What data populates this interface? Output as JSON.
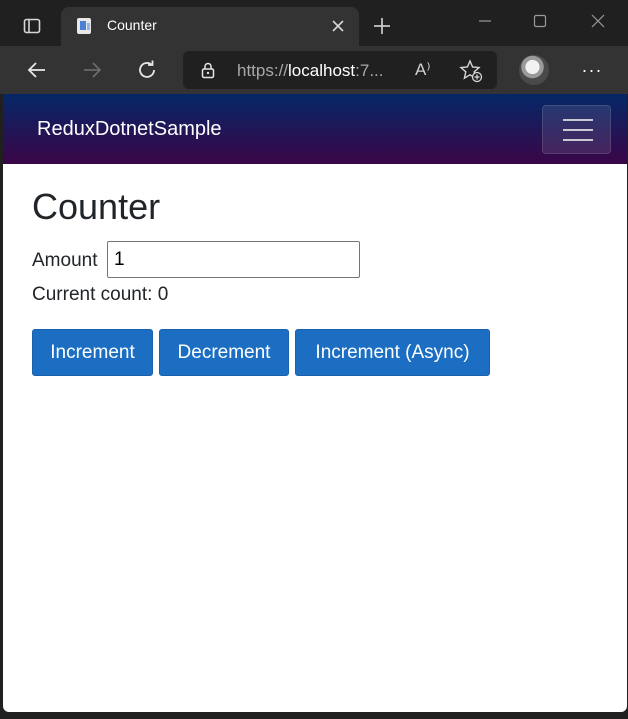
{
  "browser": {
    "tab": {
      "title": "Counter"
    },
    "address": {
      "url_prefix": "https://",
      "url_host": "localhost",
      "url_suffix": ":7..."
    },
    "readaloud_label": "A⁾",
    "menu_label": "···"
  },
  "app": {
    "brand": "ReduxDotnetSample"
  },
  "page": {
    "title": "Counter",
    "amount_label": "Amount",
    "amount_value": "1",
    "current_count_label": "Current count:",
    "current_count_value": "0",
    "buttons": {
      "increment": "Increment",
      "decrement": "Decrement",
      "increment_async": "Increment (Async)"
    }
  },
  "colors": {
    "primary_button": "#1b6ec2",
    "navbar_top": "#052767",
    "navbar_bottom": "#3a0647"
  }
}
